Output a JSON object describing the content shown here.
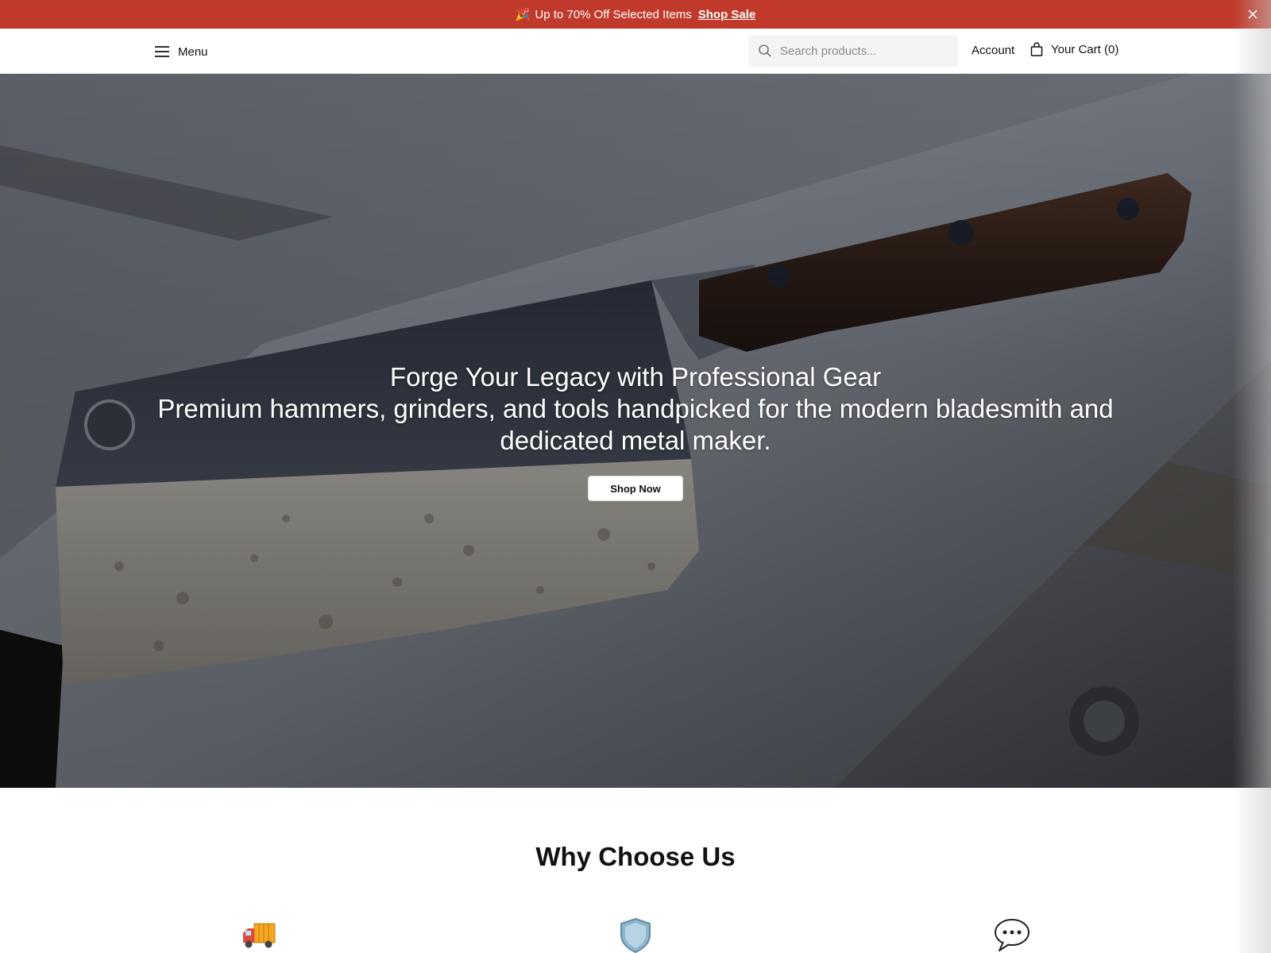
{
  "promo": {
    "emoji": "🎉",
    "text": "Up to 70% Off Selected Items",
    "link_label": "Shop Sale",
    "close_icon": "close-icon",
    "background": "#c0392b"
  },
  "header": {
    "menu_label": "Menu",
    "menu_icon": "hamburger-icon",
    "search_placeholder": "Search products...",
    "search_icon": "search-icon",
    "account_label": "Account",
    "cart_label": "Your Cart (0)",
    "cart_icon": "shopping-bag-icon"
  },
  "hero": {
    "title": "Forge Your Legacy with Professional Gear",
    "subtitle": "Premium hammers, grinders, and tools handpicked for the modern bladesmith and dedicated metal maker.",
    "cta_label": "Shop Now",
    "image_description_icon": "cleaver-on-anvil-image"
  },
  "why": {
    "title": "Why Choose Us",
    "features": [
      {
        "icon": "delivery-truck-icon"
      },
      {
        "icon": "shield-icon"
      },
      {
        "icon": "speech-bubble-icon"
      }
    ]
  }
}
